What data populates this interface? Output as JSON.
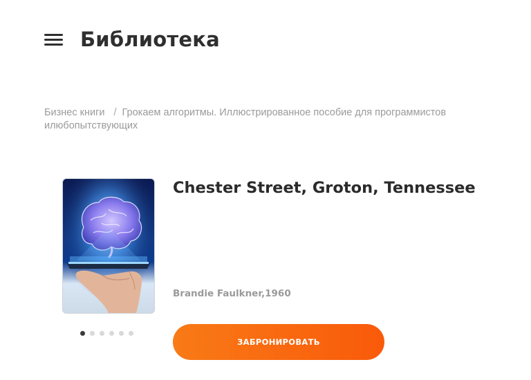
{
  "header": {
    "title": "Библиотека",
    "menu_icon": "hamburger-menu-icon"
  },
  "breadcrumb": {
    "parent": "Бизнес книги",
    "separator": "/",
    "current": "Грокаем алгоритмы. Иллюстрированное пособие для программистов илюбопытствующих"
  },
  "book": {
    "title": "Chester Street, Groton, Tennessee",
    "meta": "Brandie Faulkner,1960",
    "cover_image": "brain-hologram-over-hand-illustration",
    "gallery": {
      "count": 6,
      "active_index": 0
    }
  },
  "actions": {
    "reserve_label": "ЗАБРОНИРОВАТЬ"
  },
  "colors": {
    "accent_start": "#f97a16",
    "accent_end": "#f95a0a",
    "text_dark": "#2b2b2b",
    "text_muted": "#9a9a9a"
  }
}
